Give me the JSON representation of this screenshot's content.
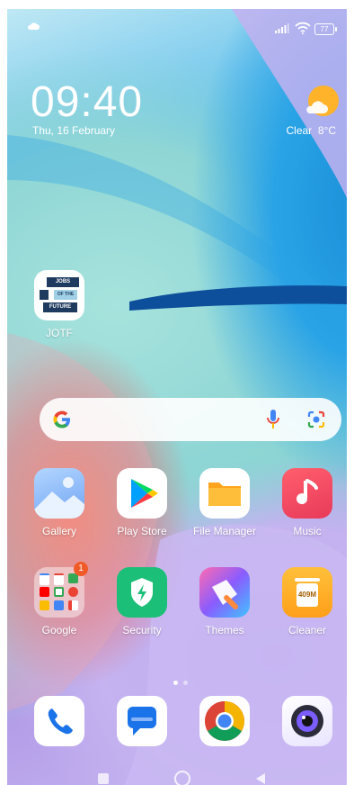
{
  "status_bar": {
    "battery": "77"
  },
  "clock": {
    "time": "09:40",
    "date": "Thu, 16 February"
  },
  "weather": {
    "condition": "Clear",
    "temperature": "8°C",
    "icon": "partly-sunny-icon"
  },
  "widget_app": {
    "label": "JOTF",
    "logo_lines": [
      "JOBS",
      "OF THE",
      "FUTURE"
    ]
  },
  "apps_row1": [
    {
      "label": "Gallery",
      "icon": "gallery-icon"
    },
    {
      "label": "Play Store",
      "icon": "play-store-icon"
    },
    {
      "label": "File Manager",
      "icon": "folder-icon"
    },
    {
      "label": "Music",
      "icon": "music-note-icon"
    }
  ],
  "apps_row2": [
    {
      "label": "Google",
      "icon": "google-folder-icon",
      "badge": "1"
    },
    {
      "label": "Security",
      "icon": "shield-bolt-icon"
    },
    {
      "label": "Themes",
      "icon": "brush-icon"
    },
    {
      "label": "Cleaner",
      "icon": "trash-icon",
      "icon_text": "409M"
    }
  ],
  "dock": [
    {
      "icon": "phone-icon"
    },
    {
      "icon": "messages-icon"
    },
    {
      "icon": "chrome-icon"
    },
    {
      "icon": "camera-icon"
    }
  ],
  "colors": {
    "accent_orange": "#ffb32a",
    "security_green": "#1bbf78",
    "music_red": "#f0405a",
    "badge_orange": "#f05a28"
  }
}
